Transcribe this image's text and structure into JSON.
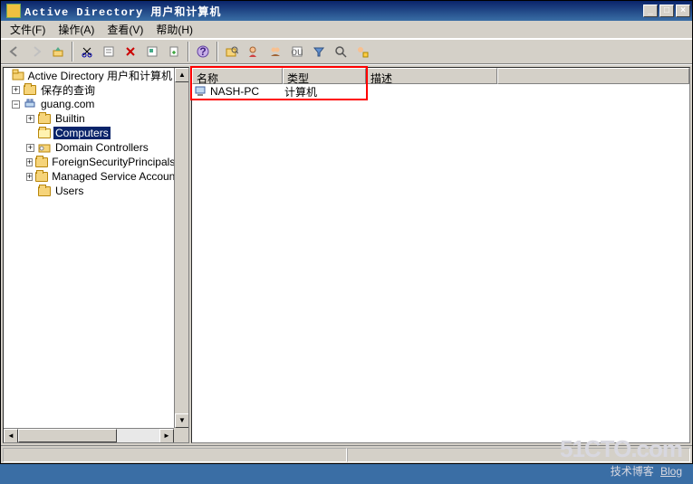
{
  "window": {
    "title": "Active Directory 用户和计算机"
  },
  "menu": {
    "file": "文件(F)",
    "action": "操作(A)",
    "view": "查看(V)",
    "help": "帮助(H)"
  },
  "tree": {
    "root": "Active Directory 用户和计算机",
    "saved": "保存的查询",
    "domain": "guang.com",
    "nodes": {
      "builtin": "Builtin",
      "computers": "Computers",
      "dc": "Domain Controllers",
      "fsp": "ForeignSecurityPrincipals",
      "msa": "Managed Service Accounts",
      "users": "Users"
    }
  },
  "columns": {
    "name": "名称",
    "type": "类型",
    "desc": "描述"
  },
  "rows": [
    {
      "name": "NASH-PC",
      "type": "计算机",
      "desc": ""
    }
  ],
  "watermark": {
    "l1": "51CTO.com",
    "l2": "技术博客",
    "l3": "Blog"
  }
}
